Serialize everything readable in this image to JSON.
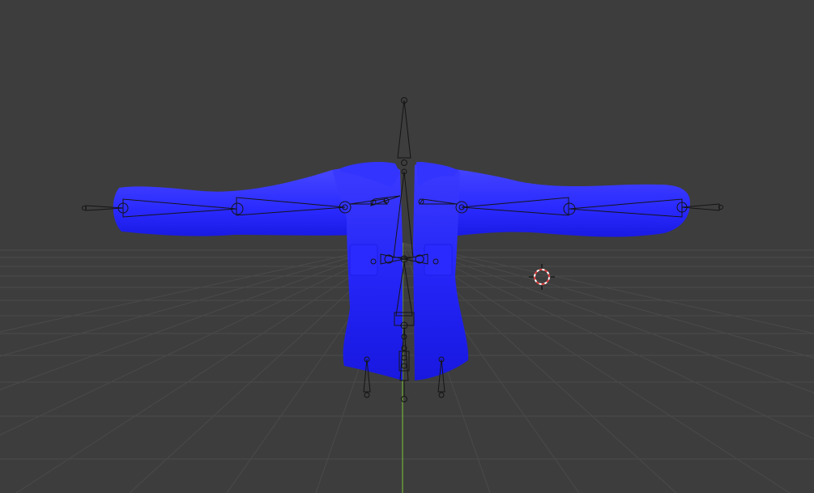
{
  "viewport": {
    "background_color": "#3d3d3d",
    "grid_color": "#4c4c4c",
    "y_axis_color": "#6a9a3a",
    "mesh_color": "#2020ff",
    "armature_line_color": "#151515",
    "cursor_colors": [
      "#e04040",
      "#ffffff"
    ]
  },
  "scene_objects": {
    "mesh": "jacket-mesh",
    "armature": "jacket-armature",
    "cursor": "3d-cursor-icon"
  }
}
